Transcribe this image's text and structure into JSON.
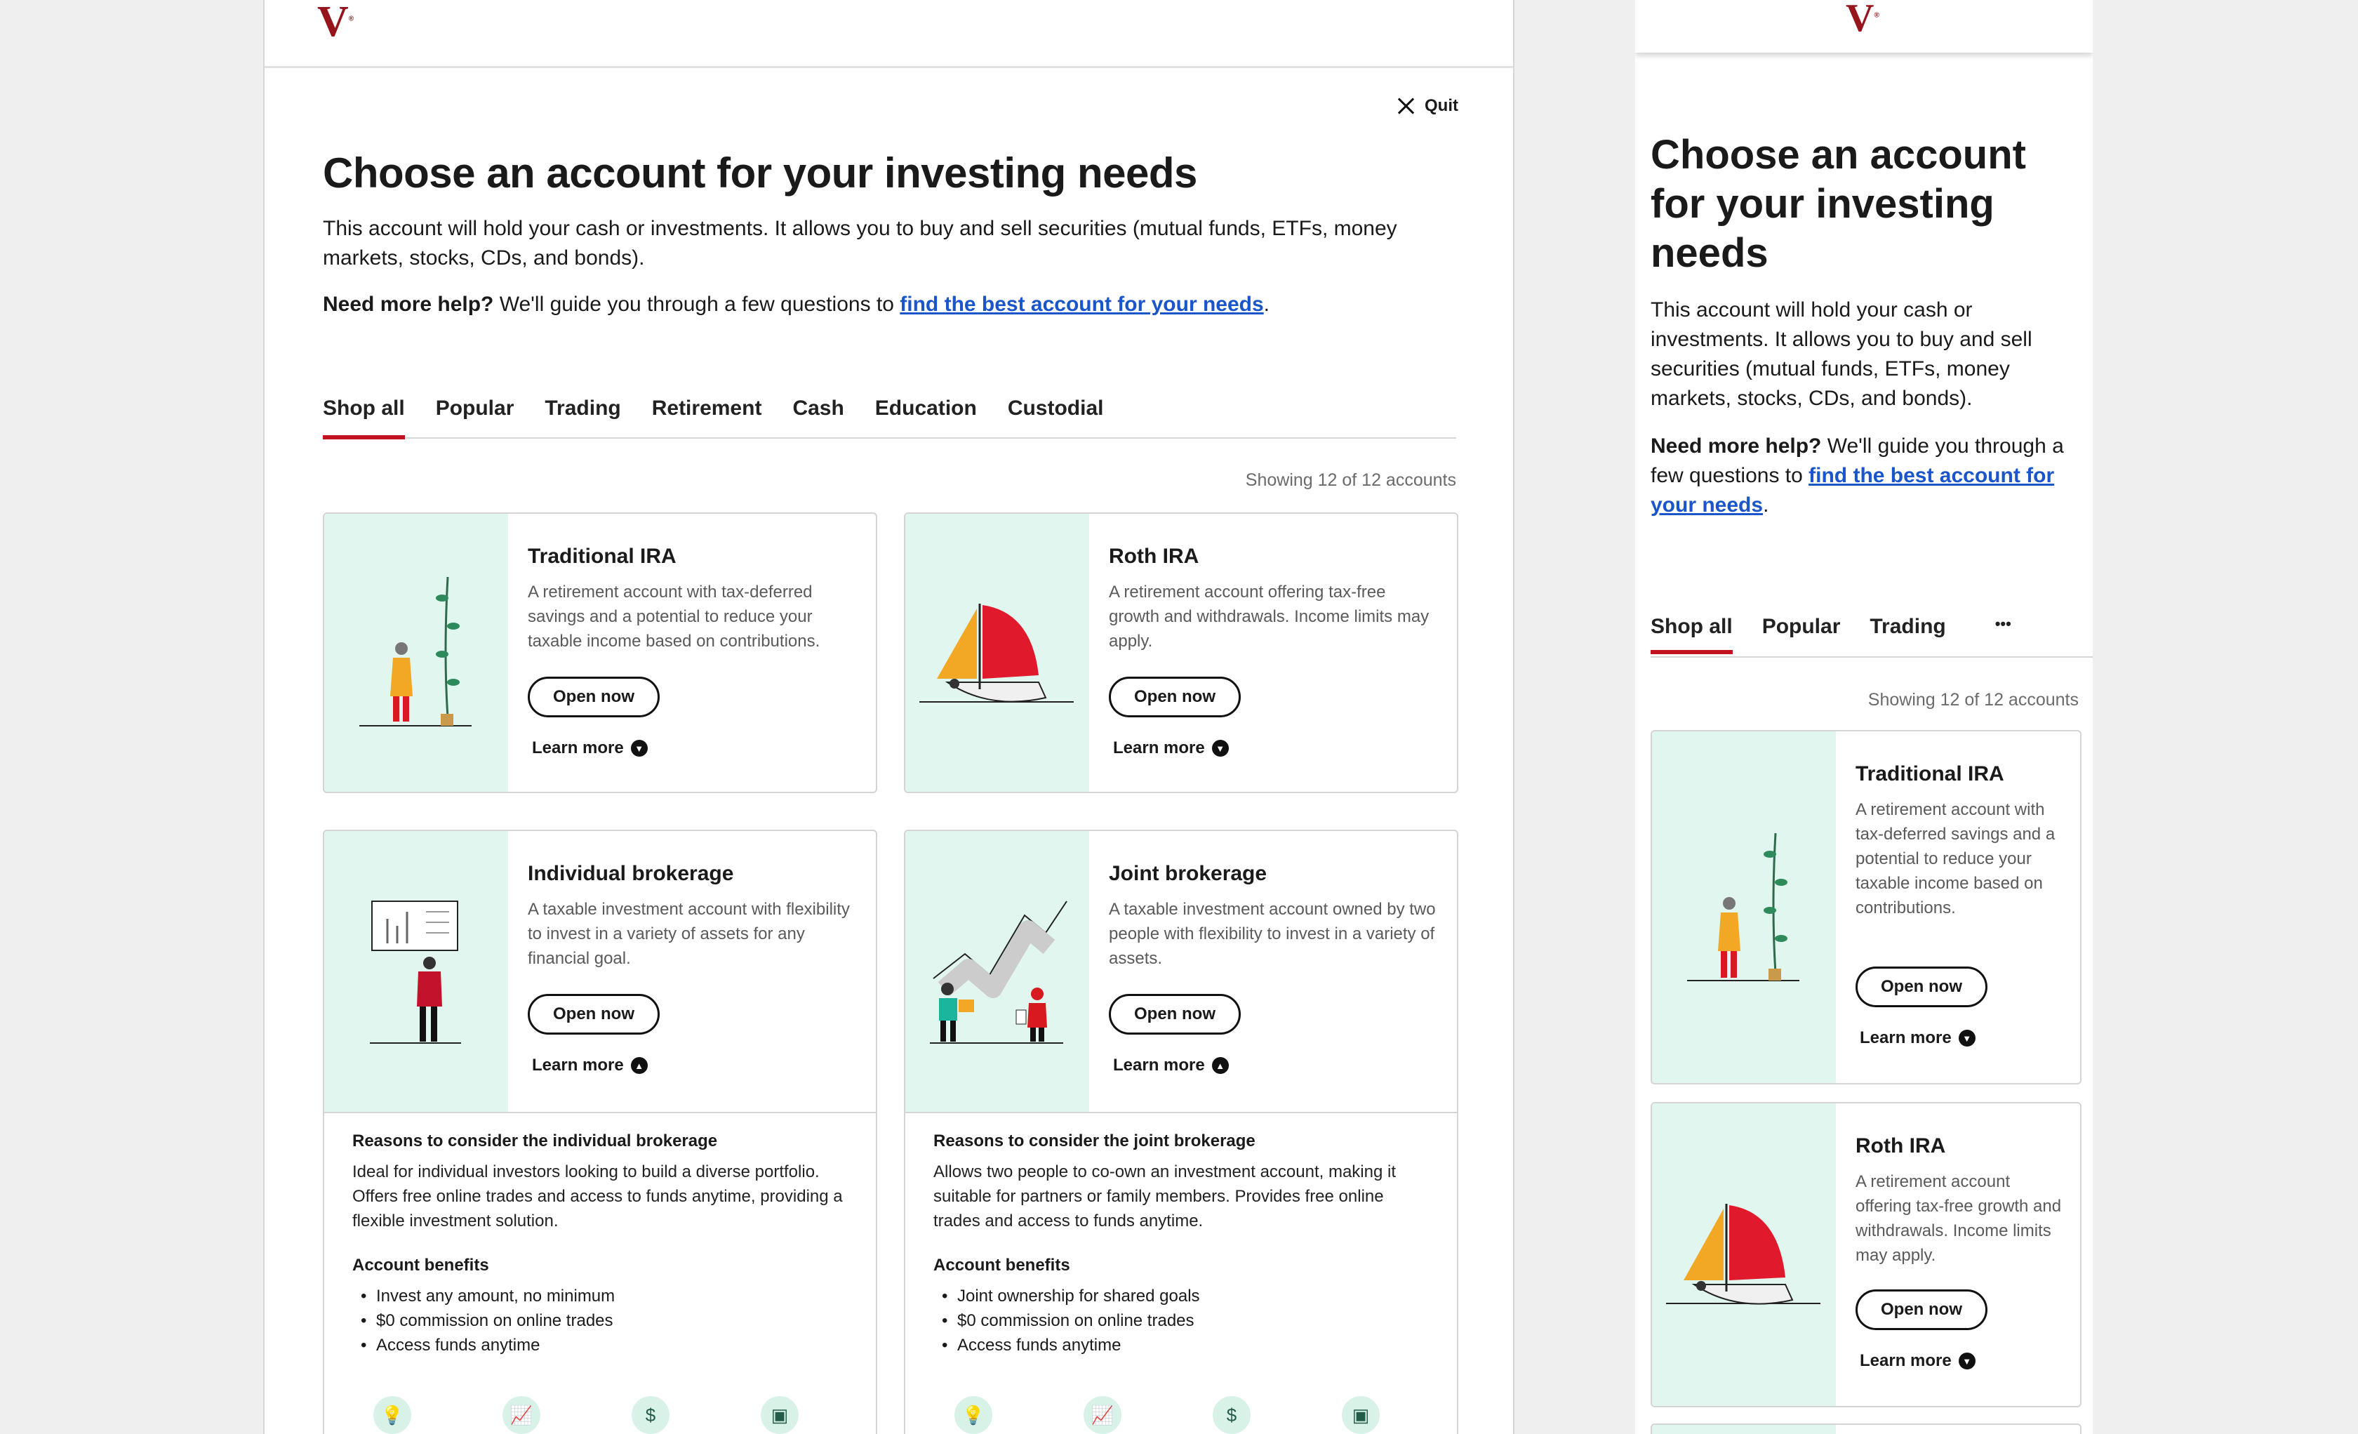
{
  "brand": {
    "logo_text": "V"
  },
  "header": {
    "quit_label": "Quit"
  },
  "page": {
    "title": "Choose an account for your investing needs",
    "intro": "This account will hold your cash or investments. It allows you to buy and sell securities (mutual funds, ETFs, money markets, stocks, CDs, and bonds).",
    "help_bold": "Need more help?",
    "help_text": " We'll guide you through a few questions to ",
    "help_link": "find the best account for your needs",
    "help_end": "."
  },
  "tabs": [
    "Shop all",
    "Popular",
    "Trading",
    "Retirement",
    "Cash",
    "Education",
    "Custodial"
  ],
  "mobile_tabs": [
    "Shop all",
    "Popular",
    "Trading"
  ],
  "more_tabs_label": "•••",
  "showing": "Showing 12 of 12 accounts",
  "buttons": {
    "open": "Open now",
    "learn": "Learn more"
  },
  "accounts": [
    {
      "title": "Traditional IRA",
      "desc": "A retirement account with tax-deferred savings and a potential to reduce your taxable income based on contributions."
    },
    {
      "title": "Roth IRA",
      "desc": "A retirement account offering tax-free growth and withdrawals. Income limits may apply."
    },
    {
      "title": "Individual brokerage",
      "desc": "A taxable investment account with flexibility to invest in a variety of assets for any financial goal.",
      "reasons_heading": "Reasons to consider the individual brokerage",
      "reasons": "Ideal for individual investors looking to build a diverse portfolio. Offers free online trades and access to funds anytime, providing a flexible investment solution.",
      "benefits_heading": "Account benefits",
      "benefits": [
        "Invest any amount, no minimum",
        "$0 commission on online trades",
        "Access funds anytime"
      ]
    },
    {
      "title": "Joint brokerage",
      "desc": "A taxable investment account owned by two people with flexibility to invest in a variety of assets.",
      "reasons_heading": "Reasons to consider the joint brokerage",
      "reasons": "Allows two people to co-own an investment account, making it suitable for partners or family members. Provides free online trades and access to funds anytime.",
      "benefits_heading": "Account benefits",
      "benefits": [
        "Joint ownership for shared goals",
        "$0 commission on online trades",
        "Access funds anytime"
      ]
    }
  ],
  "benefit_icons": [
    "bulb-icon",
    "chart-icon",
    "hand-coin-icon",
    "archive-icon"
  ],
  "colors": {
    "accent": "#c1121f",
    "link": "#1a56c9",
    "art_bg": "#e1f6ee",
    "brand": "#96151d"
  }
}
